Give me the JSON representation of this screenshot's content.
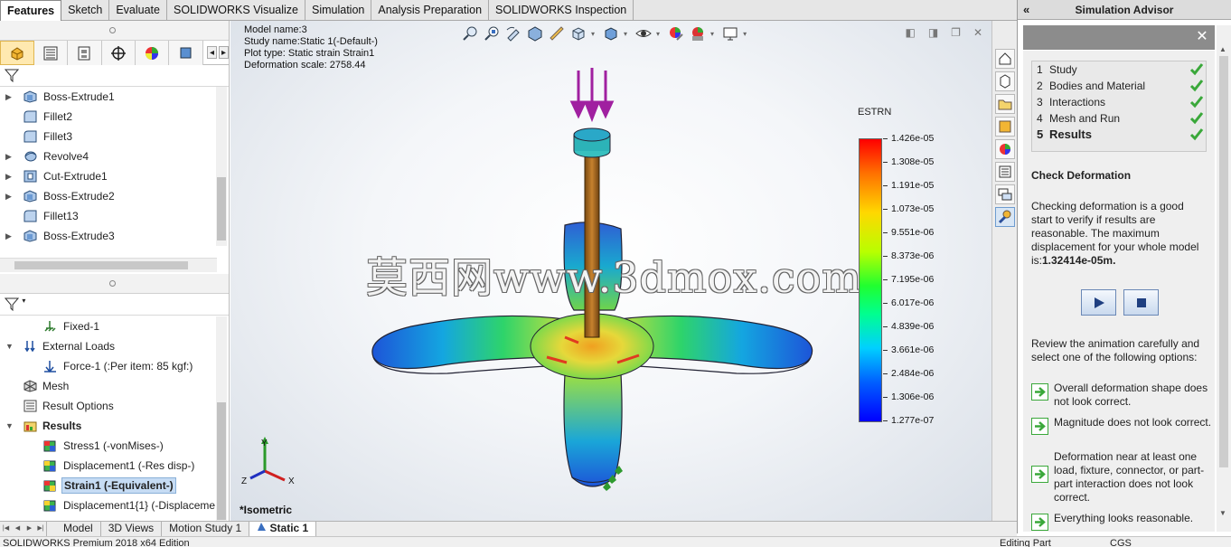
{
  "command_tabs": [
    "Features",
    "Sketch",
    "Evaluate",
    "SOLIDWORKS Visualize",
    "Simulation",
    "Analysis Preparation",
    "SOLIDWORKS Inspection"
  ],
  "feature_tree_top": [
    {
      "label": "Boss-Extrude1",
      "icon": "extrude-icon",
      "expandable": true
    },
    {
      "label": "Fillet2",
      "icon": "fillet-icon",
      "expandable": false
    },
    {
      "label": "Fillet3",
      "icon": "fillet-icon",
      "expandable": false
    },
    {
      "label": "Revolve4",
      "icon": "revolve-icon",
      "expandable": true
    },
    {
      "label": "Cut-Extrude1",
      "icon": "cut-extrude-icon",
      "expandable": true
    },
    {
      "label": "Boss-Extrude2",
      "icon": "extrude-icon",
      "expandable": true
    },
    {
      "label": "Fillet13",
      "icon": "fillet-icon",
      "expandable": false
    },
    {
      "label": "Boss-Extrude3",
      "icon": "extrude-icon",
      "expandable": true
    }
  ],
  "study_tree": {
    "fixture": "Fixed-1",
    "external_loads": "External Loads",
    "force": "Force-1 (:Per item: 85 kgf:)",
    "mesh": "Mesh",
    "result_options": "Result Options",
    "results": "Results",
    "plots": [
      {
        "label": "Stress1 (-vonMises-)",
        "selected": false
      },
      {
        "label": "Displacement1 (-Res disp-)",
        "selected": false
      },
      {
        "label": "Strain1 (-Equivalent-)",
        "selected": true
      },
      {
        "label": "Displacement1{1} (-Displaceme",
        "selected": false
      }
    ]
  },
  "plot_info": {
    "model_name": "Model name:3",
    "study_name": "Study name:Static 1(-Default-)",
    "plot_type": "Plot type: Static strain Strain1",
    "deformation": "Deformation scale: 2758.44"
  },
  "legend": {
    "title": "ESTRN",
    "ticks": [
      "1.426e-05",
      "1.308e-05",
      "1.191e-05",
      "1.073e-05",
      "9.551e-06",
      "8.373e-06",
      "7.195e-06",
      "6.017e-06",
      "4.839e-06",
      "3.661e-06",
      "2.484e-06",
      "1.306e-06",
      "1.277e-07"
    ]
  },
  "watermark": "莫西网www.3dmox.com",
  "view_name": "*Isometric",
  "triad": {
    "x": "X",
    "y": "Y",
    "z": "Z"
  },
  "advisor": {
    "title": "Simulation Advisor",
    "steps": [
      {
        "num": "1",
        "label": "Study"
      },
      {
        "num": "2",
        "label": "Bodies and Material"
      },
      {
        "num": "3",
        "label": "Interactions"
      },
      {
        "num": "4",
        "label": "Mesh and Run"
      },
      {
        "num": "5",
        "label": "Results"
      }
    ],
    "heading": "Check Deformation",
    "para1": "Checking deformation is a good start to verify if results are reasonable. The maximum displacement for your whole model is:",
    "max_disp": "1.32414e-05m.",
    "para2": "Review the animation carefully and select one of the following options:",
    "options": [
      "Overall deformation shape does not look correct.",
      "Magnitude does not look correct.",
      "Deformation near at least one load, fixture, connector, or part-part interaction does not look correct.",
      "Everything looks reasonable."
    ]
  },
  "bottom_tabs": [
    "Model",
    "3D Views",
    "Motion Study 1",
    "Static 1"
  ],
  "status": {
    "left": "SOLIDWORKS Premium 2018 x64 Edition",
    "mode": "Editing Part",
    "units": "CGS"
  },
  "colors": {
    "accent_select": "#c6dcf4",
    "check_green": "#3aa83a",
    "load_arrow": "#a020a0"
  }
}
